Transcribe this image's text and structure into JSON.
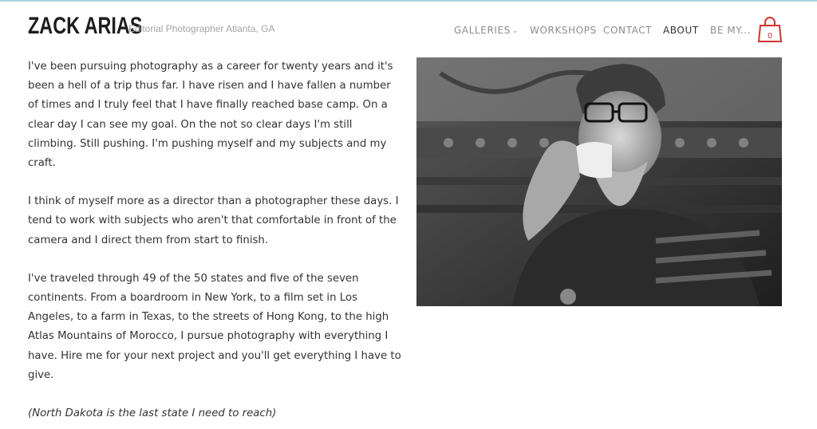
{
  "header": {
    "logo": "ZACK ARIAS",
    "tagline": "Editorial Photographer Atlanta, GA",
    "cart_count": "0"
  },
  "nav": {
    "galleries": "GALLERIES",
    "workshops": "WORKSHOPS",
    "contact": "CONTACT",
    "about": "ABOUT",
    "be_my": "BE MY..."
  },
  "icons": {
    "galleries_dropdown": "chevron-down-icon",
    "cart": "shopping-bag-icon"
  },
  "colors": {
    "cart_red": "#d0342c",
    "top_border": "#a9d3dc",
    "nav_active": "#333333",
    "nav_inactive": "#8c8c8c"
  },
  "content": {
    "p1": "I've been pursuing photography as a career for twenty years and it's been a hell of a trip thus far. I have risen and I have fallen a number of times and I truly feel that I have finally reached base camp. On a clear day I can see my goal. On the not so clear days I'm still climbing. Still pushing. I'm pushing myself and my subjects and my craft.",
    "p2": "I think of myself more as a director than a photographer these days. I tend to work with subjects who aren't that comfortable in front of the camera and I direct them from start to finish.",
    "p3": "I've traveled through 49 of the 50 states and five of the seven continents. From a boardroom in New York, to a film set in Los Angeles, to a farm in Texas, to the streets of Hong Kong, to the high Atlas Mountains of Morocco, I pursue photography with everything I have. Hire me for your next project and you'll get everything I have to give.",
    "note": "(North Dakota is the last state I need to reach)"
  }
}
